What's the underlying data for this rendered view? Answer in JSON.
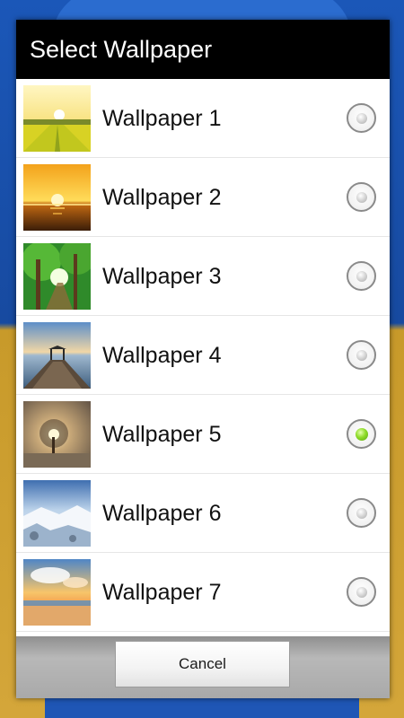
{
  "dialog": {
    "title": "Select Wallpaper",
    "cancel_label": "Cancel"
  },
  "wallpapers": [
    {
      "label": "Wallpaper 1",
      "thumbnail": "yellow-field-sunrise",
      "selected": false
    },
    {
      "label": "Wallpaper 2",
      "thumbnail": "ocean-sunset",
      "selected": false
    },
    {
      "label": "Wallpaper 3",
      "thumbnail": "green-forest-path",
      "selected": false
    },
    {
      "label": "Wallpaper 4",
      "thumbnail": "pier-gazebo-sea",
      "selected": false
    },
    {
      "label": "Wallpaper 5",
      "thumbnail": "tree-backlit-sun",
      "selected": true
    },
    {
      "label": "Wallpaper 6",
      "thumbnail": "snowy-rocky-coast",
      "selected": false
    },
    {
      "label": "Wallpaper 7",
      "thumbnail": "beach-sunset-clouds",
      "selected": false
    }
  ],
  "colors": {
    "header_bg": "#000000",
    "selected_radio": "#8fdc2a"
  }
}
